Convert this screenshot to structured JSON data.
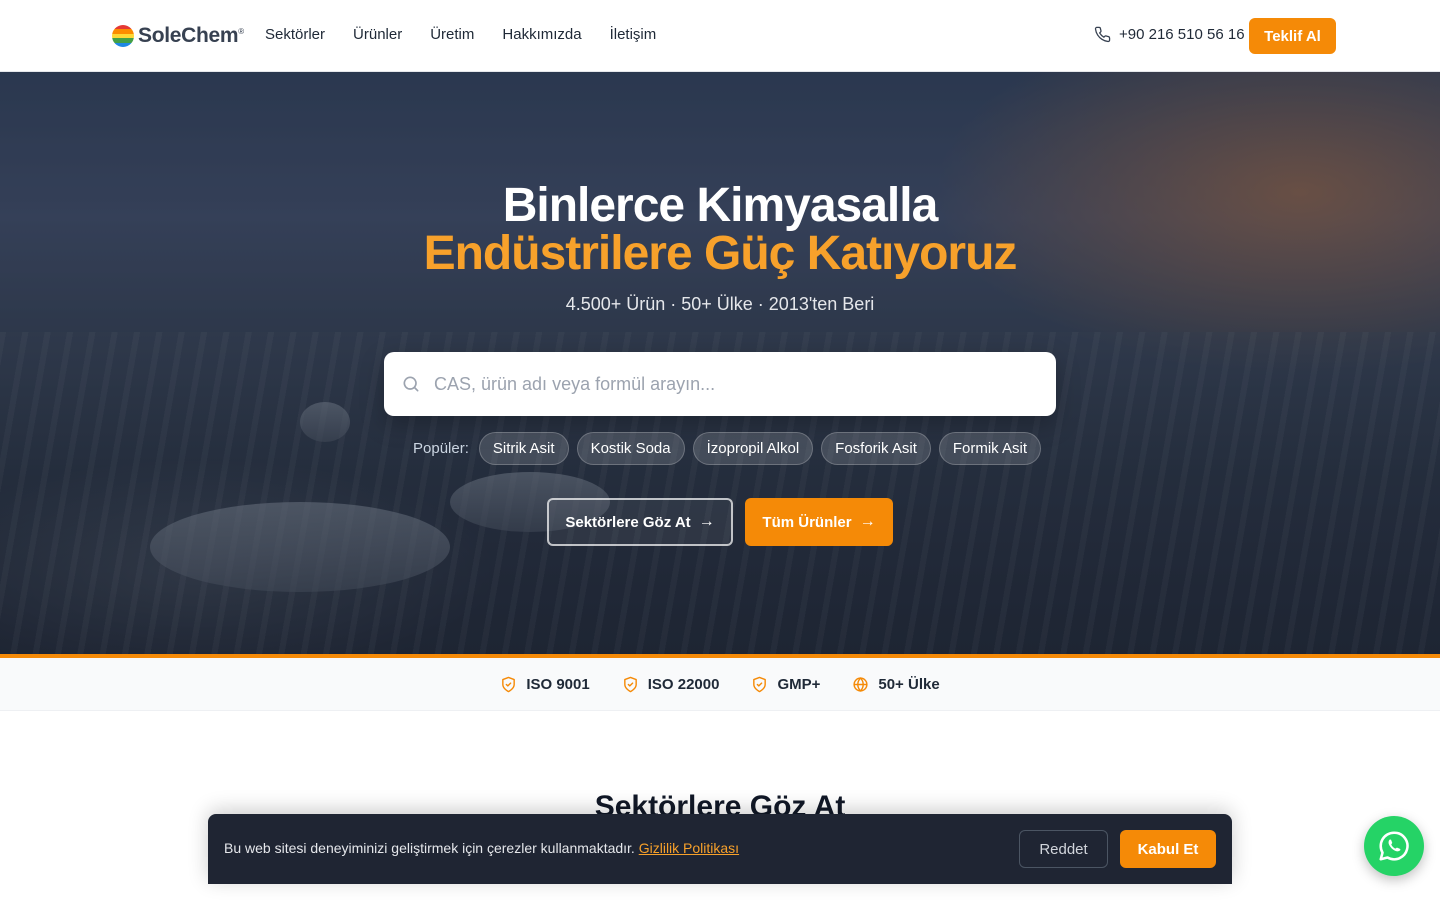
{
  "colors": {
    "accent": "#f58a07",
    "accent_text": "#f7a12b",
    "dark_banner": "#1f2533",
    "whatsapp": "#25d366"
  },
  "header": {
    "logo_text": "SoleChem",
    "logo_mark": "®",
    "nav": [
      {
        "label": "Sektörler"
      },
      {
        "label": "Ürünler"
      },
      {
        "label": "Üretim"
      },
      {
        "label": "Hakkımızda"
      },
      {
        "label": "İletişim"
      }
    ],
    "phone": "+90 216 510 56 16",
    "quote_button": "Teklif Al"
  },
  "hero": {
    "title_line1": "Binlerce Kimyasalla",
    "title_line2": "Endüstrilere Güç Katıyoruz",
    "subtitle": "4.500+ Ürün · 50+ Ülke · 2013'ten Beri",
    "search_placeholder": "CAS, ürün adı veya formül arayın...",
    "popular_label": "Popüler:",
    "popular": [
      {
        "label": "Sitrik Asit"
      },
      {
        "label": "Kostik Soda"
      },
      {
        "label": "İzopropil Alkol"
      },
      {
        "label": "Fosforik Asit"
      },
      {
        "label": "Formik Asit"
      }
    ],
    "btn_sectors": "Sektörlere Göz At",
    "btn_products": "Tüm Ürünler"
  },
  "certs": [
    {
      "label": "ISO 9001",
      "icon": "shield-check-icon"
    },
    {
      "label": "ISO 22000",
      "icon": "shield-check-icon"
    },
    {
      "label": "GMP+",
      "icon": "shield-check-icon"
    },
    {
      "label": "50+ Ülke",
      "icon": "globe-icon"
    }
  ],
  "section": {
    "title": "Sektörlere Göz At"
  },
  "cookie": {
    "text": "Bu web sitesi deneyiminizi geliştirmek için çerezler kullanmaktadır.",
    "link": "Gizlilik Politikası",
    "reject": "Reddet",
    "accept": "Kabul Et"
  }
}
